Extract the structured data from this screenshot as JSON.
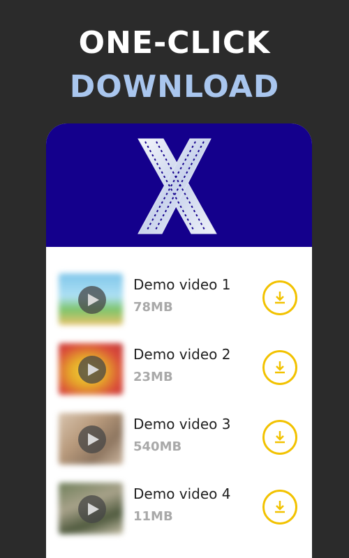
{
  "headline": {
    "line1": "ONE-CLICK",
    "line2": "DOWNLOAD"
  },
  "colors": {
    "background": "#2b2b2b",
    "headline_primary": "#ffffff",
    "headline_accent": "#a9c6ee",
    "app_header": "#14008c",
    "download_accent": "#f2c200"
  },
  "app": {
    "logo_icon": "x-film-strip-logo-icon"
  },
  "videos": [
    {
      "title": "Demo video 1",
      "size": "78MB",
      "thumb_icon": "play-icon",
      "action_icon": "download-icon"
    },
    {
      "title": "Demo video 2",
      "size": "23MB",
      "thumb_icon": "play-icon",
      "action_icon": "download-icon"
    },
    {
      "title": "Demo video 3",
      "size": "540MB",
      "thumb_icon": "play-icon",
      "action_icon": "download-icon"
    },
    {
      "title": "Demo video 4",
      "size": "11MB",
      "thumb_icon": "play-icon",
      "action_icon": "download-icon"
    }
  ]
}
